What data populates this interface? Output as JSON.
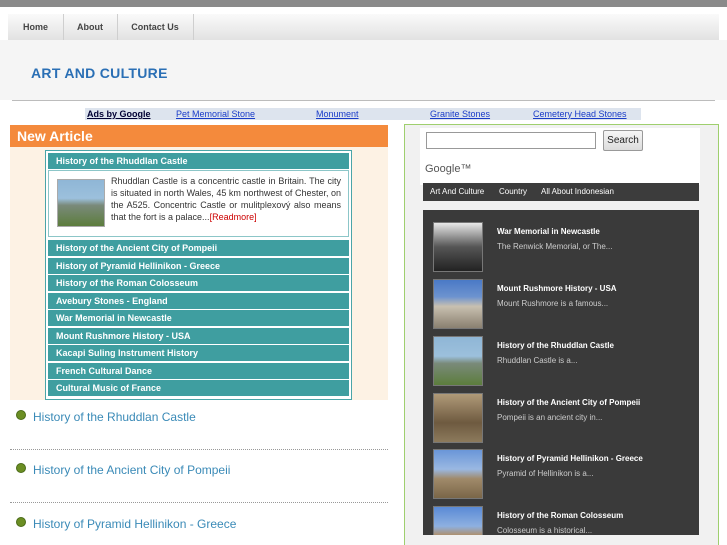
{
  "nav": {
    "items": [
      "Home",
      "About",
      "Contact Us"
    ]
  },
  "site": {
    "title": "ART AND CULTURE"
  },
  "ads": {
    "label": "Ads by Google",
    "links": [
      "Pet Memorial Stone",
      "Monument",
      "Granite Stones",
      "Cemetery Head Stones"
    ]
  },
  "new_article": {
    "heading": "New Article",
    "open_item": {
      "title": "History of the Rhuddlan Castle",
      "text": "Rhuddlan Castle is a concentric castle in Britain. The city is situated in north Wales, 45 km northwest of Chester, on the A525. Concentric Castle or mulitplexový also means that the fort is a palace...",
      "readmore": "[Readmore]"
    },
    "items": [
      "History of the Ancient City of Pompeii",
      "History of Pyramid Hellinikon - Greece",
      "History of the Roman Colosseum",
      "Avebury Stones - England",
      "War Memorial in Newcastle",
      "Mount Rushmore History - USA",
      "Kacapi Suling Instrument History",
      "French Cultural Dance",
      "Cultural Music of France"
    ]
  },
  "post_list": [
    "History of the Rhuddlan Castle",
    "History of the Ancient City of Pompeii",
    "History of Pyramid Hellinikon - Greece"
  ],
  "search": {
    "button": "Search",
    "logo": "Google™"
  },
  "tabs": [
    "Art And Culture",
    "Country",
    "All About Indonesian"
  ],
  "recent": [
    {
      "title": "War Memorial in Newcastle",
      "desc": "The Renwick Memorial, or The..."
    },
    {
      "title": "Mount Rushmore History - USA",
      "desc": "Mount Rushmore is a famous..."
    },
    {
      "title": "History of the Rhuddlan Castle",
      "desc": "Rhuddlan Castle is a..."
    },
    {
      "title": "History of the Ancient City of Pompeii",
      "desc": "Pompeii is an ancient city in..."
    },
    {
      "title": "History of Pyramid Hellinikon - Greece",
      "desc": "Pyramid of Hellinikon is a..."
    },
    {
      "title": "History of the Roman Colosseum",
      "desc": "Colosseum is a historical..."
    }
  ],
  "colors": {
    "accent": "#f48a3c",
    "teal": "#3f9ea0",
    "title_blue": "#2a6fb5",
    "link_blue": "#3a8ab7"
  }
}
